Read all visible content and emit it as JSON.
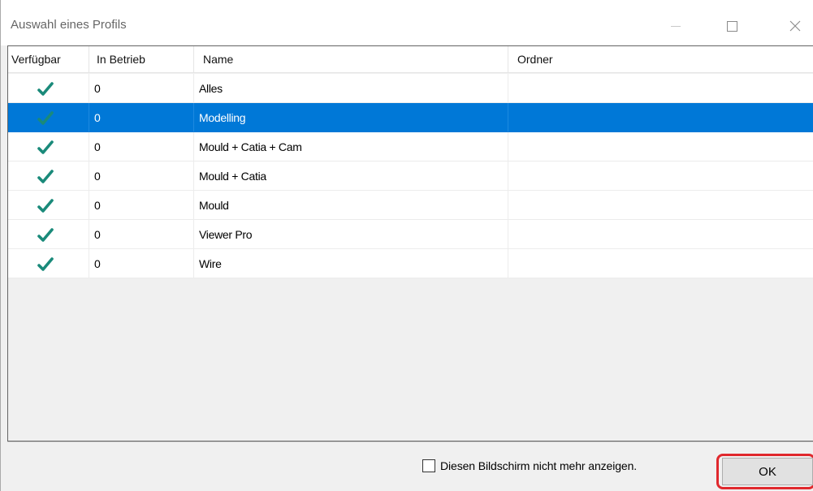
{
  "window": {
    "title": "Auswahl eines Profils"
  },
  "table": {
    "columns": [
      "Verfügbar",
      "In Betrieb",
      "Name",
      "Ordner"
    ],
    "rows": [
      {
        "available": true,
        "in_operation": "0",
        "name": "Alles",
        "folder": "",
        "selected": false
      },
      {
        "available": true,
        "in_operation": "0",
        "name": "Modelling",
        "folder": "",
        "selected": true
      },
      {
        "available": true,
        "in_operation": "0",
        "name": "Mould + Catia + Cam",
        "folder": "",
        "selected": false
      },
      {
        "available": true,
        "in_operation": "0",
        "name": "Mould + Catia",
        "folder": "",
        "selected": false
      },
      {
        "available": true,
        "in_operation": "0",
        "name": "Mould",
        "folder": "",
        "selected": false
      },
      {
        "available": true,
        "in_operation": "0",
        "name": "Viewer Pro",
        "folder": "",
        "selected": false
      },
      {
        "available": true,
        "in_operation": "0",
        "name": "Wire",
        "folder": "",
        "selected": false
      }
    ]
  },
  "footer": {
    "dont_show_label": "Diesen Bildschirm nicht mehr anzeigen.",
    "dont_show_checked": false,
    "ok_label": "OK"
  },
  "icons": {
    "available": "checkmark-icon",
    "minimize": "minimize-icon",
    "maximize": "maximize-icon",
    "close": "close-icon"
  },
  "colors": {
    "check": "#1a8a7a",
    "selection": "#0078d7",
    "highlight_border": "#e0282d"
  }
}
